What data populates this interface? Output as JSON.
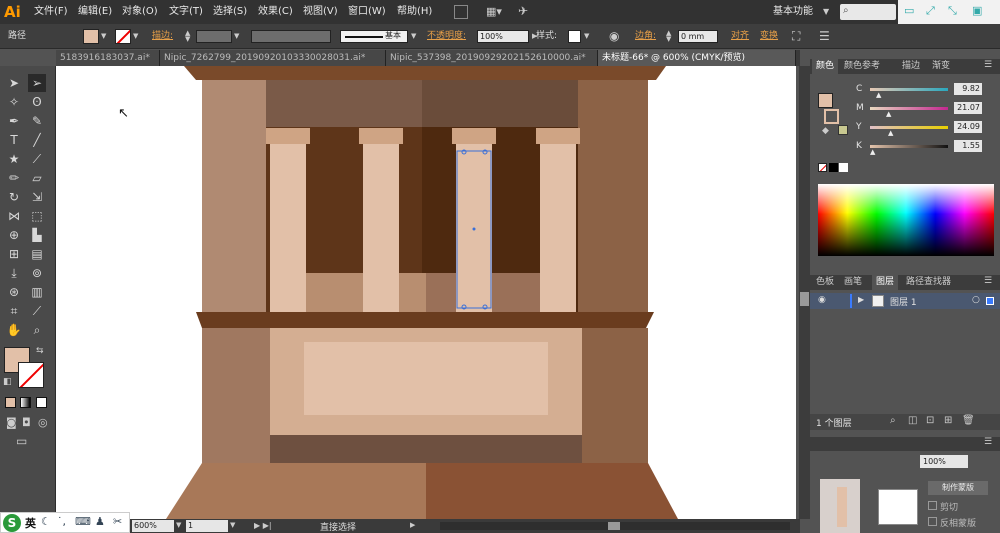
{
  "app": {
    "logo": "Ai",
    "workspace": "基本功能"
  },
  "menus": [
    "文件(F)",
    "编辑(E)",
    "对象(O)",
    "文字(T)",
    "选择(S)",
    "效果(C)",
    "视图(V)",
    "窗口(W)",
    "帮助(H)"
  ],
  "control": {
    "selection": "路径",
    "stroke_label": "描边:",
    "stroke_style": "基本",
    "opacity_label": "不透明度:",
    "opacity_value": "100%",
    "style_label": "样式:",
    "corner_label": "边角:",
    "corner_value": "0 mm",
    "align_label": "对齐",
    "transform_label": "变换"
  },
  "tabs": [
    {
      "label": "5183916183037.ai*"
    },
    {
      "label": "Nipic_7262799_20190920103330028031.ai*"
    },
    {
      "label": "Nipic_537398_20190929202152610000.ai*"
    },
    {
      "label": "未标题-66* @ 600% (CMYK/预览)"
    }
  ],
  "status": {
    "zoom": "600%",
    "page": "1",
    "tool": "直接选择"
  },
  "ime": {
    "lang": "英"
  },
  "color_panel": {
    "tabs": [
      "颜色",
      "颜色参考",
      "描边",
      "渐变"
    ],
    "channels": [
      {
        "name": "C",
        "value": "9.82",
        "level": 0.098
      },
      {
        "name": "M",
        "value": "21.07",
        "level": 0.21
      },
      {
        "name": "Y",
        "value": "24.09",
        "level": 0.24
      },
      {
        "name": "K",
        "value": "1.55",
        "level": 0.016
      }
    ],
    "fill_color": "#e2c0a8"
  },
  "layers_panel": {
    "tabs": [
      "色板",
      "画笔",
      "图层",
      "路径查找器"
    ],
    "layer_name": "图层 1",
    "footer": "1 个图层"
  },
  "transparency_panel": {
    "opacity": "100%",
    "clip_label": "剪切",
    "invert_label": "反相蒙版",
    "make_mask_label": "制作蒙版"
  },
  "colors": {
    "fill": "#e2c0a8",
    "dark_brown": "#5e3519",
    "mid_brown": "#7a5a48",
    "tan": "#c49a7c",
    "light": "#e2c0a8"
  }
}
